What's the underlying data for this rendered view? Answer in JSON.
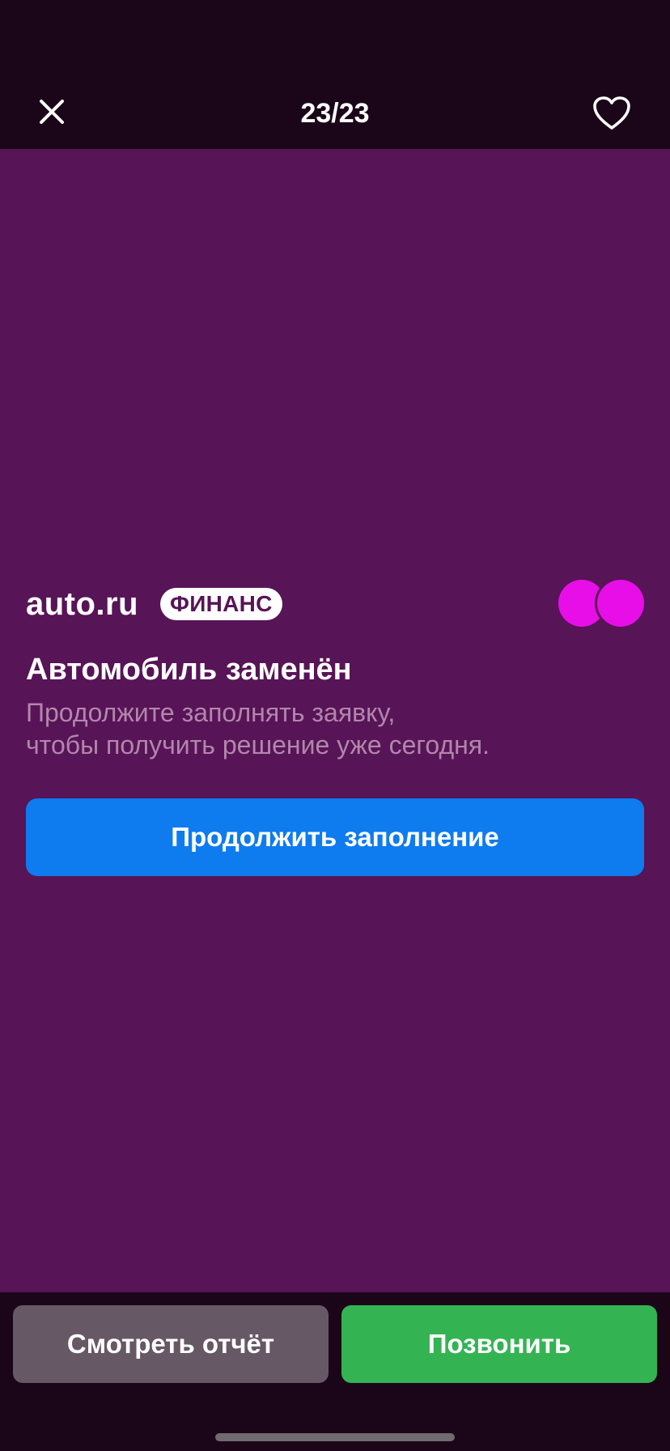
{
  "header": {
    "counter": "23/23",
    "close_icon": "close-icon",
    "favorite_icon": "heart-outline-icon"
  },
  "banner": {
    "brand": "auto.ru",
    "badge": "ФИНАНС",
    "title": "Автомобиль заменён",
    "subtitle_line1": "Продолжите заполнять заявку,",
    "subtitle_line2": "чтобы получить решение уже сегодня.",
    "cta_label": "Продолжить заполнение",
    "logo_icon": "two-circles-icon"
  },
  "footer": {
    "report_label": "Смотреть отчёт",
    "call_label": "Позвонить"
  },
  "colors": {
    "background": "#1b0619",
    "slide": "#571456",
    "cta": "#0e7bef",
    "call": "#34b353",
    "report": "#675865",
    "accent_circles": "#e80ee8"
  }
}
